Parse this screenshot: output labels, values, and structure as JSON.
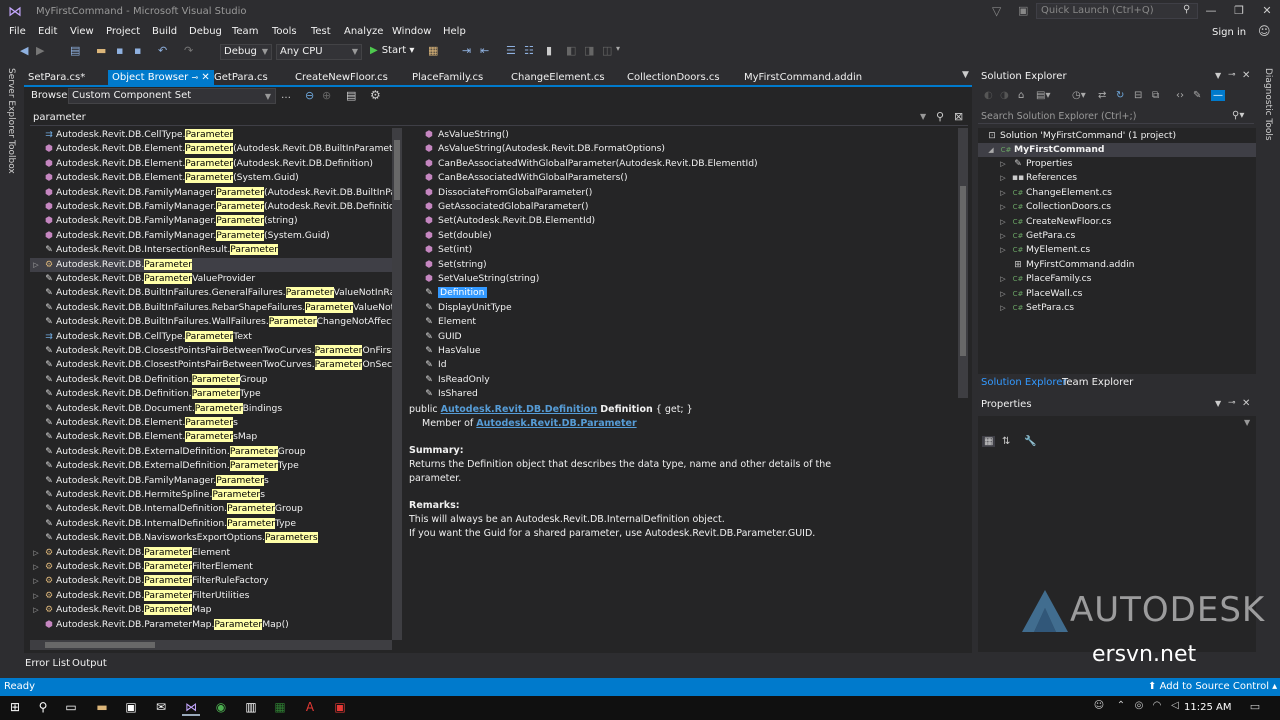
{
  "window": {
    "title": "MyFirstCommand - Microsoft Visual Studio",
    "quick_launch_placeholder": "Quick Launch (Ctrl+Q)",
    "sign_in": "Sign in"
  },
  "menu": [
    "File",
    "Edit",
    "View",
    "Project",
    "Build",
    "Debug",
    "Team",
    "Tools",
    "Test",
    "Analyze",
    "Window",
    "Help"
  ],
  "toolbar": {
    "config": "Debug",
    "platform": "Any CPU",
    "start": "Start"
  },
  "side_tabs": {
    "left": [
      "Server Explorer",
      "Toolbox"
    ],
    "right": [
      "Diagnostic Tools"
    ]
  },
  "doc_tabs": [
    "SetPara.cs*",
    "Object Browser",
    "GetPara.cs",
    "CreateNewFloor.cs",
    "PlaceFamily.cs",
    "ChangeElement.cs",
    "CollectionDoors.cs",
    "MyFirstCommand.addin"
  ],
  "object_browser": {
    "browse_label": "Browse:",
    "browse_value": "Custom Component Set",
    "search_value": "parameter",
    "tree": [
      {
        "pre": "Autodesk.Revit.DB.CellType.",
        "hl": "Parameter",
        "post": "",
        "icon": "enum",
        "exp": ""
      },
      {
        "pre": "Autodesk.Revit.DB.Element.",
        "hl": "Parameter",
        "post": "(Autodesk.Revit.DB.BuiltInParameter)",
        "icon": "method",
        "exp": ""
      },
      {
        "pre": "Autodesk.Revit.DB.Element.",
        "hl": "Parameter",
        "post": "(Autodesk.Revit.DB.Definition)",
        "icon": "method",
        "exp": ""
      },
      {
        "pre": "Autodesk.Revit.DB.Element.",
        "hl": "Parameter",
        "post": "(System.Guid)",
        "icon": "method",
        "exp": ""
      },
      {
        "pre": "Autodesk.Revit.DB.FamilyManager.",
        "hl": "Parameter",
        "post": "(Autodesk.Revit.DB.BuiltInParame",
        "icon": "method",
        "exp": ""
      },
      {
        "pre": "Autodesk.Revit.DB.FamilyManager.",
        "hl": "Parameter",
        "post": "(Autodesk.Revit.DB.Definition)",
        "icon": "method",
        "exp": ""
      },
      {
        "pre": "Autodesk.Revit.DB.FamilyManager.",
        "hl": "Parameter",
        "post": "(string)",
        "icon": "method",
        "exp": ""
      },
      {
        "pre": "Autodesk.Revit.DB.FamilyManager.",
        "hl": "Parameter",
        "post": "(System.Guid)",
        "icon": "method",
        "exp": ""
      },
      {
        "pre": "Autodesk.Revit.DB.IntersectionResult.",
        "hl": "Parameter",
        "post": "",
        "icon": "prop",
        "exp": ""
      },
      {
        "pre": "Autodesk.Revit.DB.",
        "hl": "Parameter",
        "post": "",
        "icon": "class",
        "exp": "▷",
        "selected": true
      },
      {
        "pre": "Autodesk.Revit.DB.",
        "hl": "Parameter",
        "post": "ValueProvider",
        "icon": "prop",
        "pre2": "Autodesk.Revit.DB.ParameterValueProvider.",
        "custom": true
      },
      {
        "pre": "Autodesk.Revit.DB.BuiltInFailures.GeneralFailures.",
        "hl": "Parameter",
        "post": "ValueNotInRange",
        "icon": "prop",
        "exp": ""
      },
      {
        "pre": "Autodesk.Revit.DB.BuiltInFailures.RebarShapeFailures.",
        "hl": "Parameter",
        "post": "ValueNotDefine",
        "icon": "prop",
        "exp": ""
      },
      {
        "pre": "Autodesk.Revit.DB.BuiltInFailures.WallFailures.",
        "hl": "Parameter",
        "post": "ChangeNotAffectingG",
        "icon": "prop",
        "exp": ""
      },
      {
        "pre": "Autodesk.Revit.DB.CellType.",
        "hl": "Parameter",
        "post": "Text",
        "icon": "enum",
        "exp": ""
      },
      {
        "pre": "Autodesk.Revit.DB.ClosestPointsPairBetweenTwoCurves.",
        "hl": "Parameter",
        "post": "OnFirstCurv",
        "icon": "prop",
        "exp": ""
      },
      {
        "pre": "Autodesk.Revit.DB.ClosestPointsPairBetweenTwoCurves.",
        "hl": "Parameter",
        "post": "OnSecondC",
        "icon": "prop",
        "exp": ""
      },
      {
        "pre": "Autodesk.Revit.DB.Definition.",
        "hl": "Parameter",
        "post": "Group",
        "icon": "prop",
        "exp": ""
      },
      {
        "pre": "Autodesk.Revit.DB.Definition.",
        "hl": "Parameter",
        "post": "Type",
        "icon": "prop",
        "exp": ""
      },
      {
        "pre": "Autodesk.Revit.DB.Document.",
        "hl": "Parameter",
        "post": "Bindings",
        "icon": "prop",
        "exp": ""
      },
      {
        "pre": "Autodesk.Revit.DB.Element.",
        "hl": "Parameter",
        "post": "s",
        "icon": "prop",
        "exp": ""
      },
      {
        "pre": "Autodesk.Revit.DB.Element.",
        "hl": "Parameter",
        "post": "sMap",
        "icon": "prop",
        "exp": ""
      },
      {
        "pre": "Autodesk.Revit.DB.ExternalDefinition.",
        "hl": "Parameter",
        "post": "Group",
        "icon": "prop",
        "exp": ""
      },
      {
        "pre": "Autodesk.Revit.DB.ExternalDefinition.",
        "hl": "Parameter",
        "post": "Type",
        "icon": "prop",
        "exp": ""
      },
      {
        "pre": "Autodesk.Revit.DB.FamilyManager.",
        "hl": "Parameter",
        "post": "s",
        "icon": "prop",
        "exp": ""
      },
      {
        "pre": "Autodesk.Revit.DB.HermiteSpline.",
        "hl": "Parameter",
        "post": "s",
        "icon": "prop",
        "exp": ""
      },
      {
        "pre": "Autodesk.Revit.DB.InternalDefinition.",
        "hl": "Parameter",
        "post": "Group",
        "icon": "prop",
        "exp": ""
      },
      {
        "pre": "Autodesk.Revit.DB.InternalDefinition.",
        "hl": "Parameter",
        "post": "Type",
        "icon": "prop",
        "exp": ""
      },
      {
        "pre": "Autodesk.Revit.DB.NavisworksExportOptions.",
        "hl": "Parameters",
        "post": "",
        "icon": "prop",
        "exp": ""
      },
      {
        "pre": "Autodesk.Revit.DB.",
        "hl": "Parameter",
        "post": "Element",
        "icon": "class",
        "exp": "▷"
      },
      {
        "pre": "Autodesk.Revit.DB.",
        "hl": "Parameter",
        "post": "FilterElement",
        "icon": "class",
        "exp": "▷"
      },
      {
        "pre": "Autodesk.Revit.DB.",
        "hl": "Parameter",
        "post": "FilterRuleFactory",
        "icon": "class",
        "exp": "▷"
      },
      {
        "pre": "Autodesk.Revit.DB.",
        "hl": "Parameter",
        "post": "FilterUtilities",
        "icon": "class",
        "exp": "▷"
      },
      {
        "pre": "Autodesk.Revit.DB.",
        "hl": "Parameter",
        "post": "Map",
        "icon": "class",
        "exp": "▷"
      },
      {
        "pre": "Autodesk.Revit.DB.ParameterMap.",
        "hl": "Parameter",
        "post": "Map()",
        "icon": "method",
        "exp": ""
      }
    ],
    "members": [
      {
        "name": "AsValueString()",
        "kind": "method"
      },
      {
        "name": "AsValueString(Autodesk.Revit.DB.FormatOptions)",
        "kind": "method"
      },
      {
        "name": "CanBeAssociatedWithGlobalParameter(Autodesk.Revit.DB.ElementId)",
        "kind": "method"
      },
      {
        "name": "CanBeAssociatedWithGlobalParameters()",
        "kind": "method"
      },
      {
        "name": "DissociateFromGlobalParameter()",
        "kind": "method"
      },
      {
        "name": "GetAssociatedGlobalParameter()",
        "kind": "method"
      },
      {
        "name": "Set(Autodesk.Revit.DB.ElementId)",
        "kind": "method"
      },
      {
        "name": "Set(double)",
        "kind": "method"
      },
      {
        "name": "Set(int)",
        "kind": "method"
      },
      {
        "name": "Set(string)",
        "kind": "method"
      },
      {
        "name": "SetValueString(string)",
        "kind": "method"
      },
      {
        "name": "Definition",
        "kind": "prop",
        "selected": true
      },
      {
        "name": "DisplayUnitType",
        "kind": "prop"
      },
      {
        "name": "Element",
        "kind": "prop"
      },
      {
        "name": "GUID",
        "kind": "prop"
      },
      {
        "name": "HasValue",
        "kind": "prop"
      },
      {
        "name": "Id",
        "kind": "prop"
      },
      {
        "name": "IsReadOnly",
        "kind": "prop"
      },
      {
        "name": "IsShared",
        "kind": "prop"
      }
    ],
    "description": {
      "decl_public": "public",
      "decl_type": "Autodesk.Revit.DB.Definition",
      "decl_name": "Definition",
      "decl_accessors": "{ get; }",
      "member_of_label": "Member of",
      "member_of_link": "Autodesk.Revit.DB.Parameter",
      "summary_label": "Summary:",
      "summary_line1": "Returns the Definition object that describes the data type, name and other details of the",
      "summary_line2": "parameter.",
      "remarks_label": "Remarks:",
      "remarks_line1": "This will always be an Autodesk.Revit.DB.InternalDefinition object.",
      "remarks_line2": "If you want the Guid for a shared parameter, use Autodesk.Revit.DB.Parameter.GUID."
    }
  },
  "bottom_tabs": [
    "Error List",
    "Output"
  ],
  "solution_explorer": {
    "title": "Solution Explorer",
    "search_placeholder": "Search Solution Explorer (Ctrl+;)",
    "solution": "Solution 'MyFirstCommand' (1 project)",
    "project": "MyFirstCommand",
    "items": [
      {
        "name": "Properties",
        "icon": "wrench",
        "exp": "▷"
      },
      {
        "name": "References",
        "icon": "ref",
        "exp": "▷"
      },
      {
        "name": "ChangeElement.cs",
        "icon": "cs",
        "exp": "▷"
      },
      {
        "name": "CollectionDoors.cs",
        "icon": "cs",
        "exp": "▷"
      },
      {
        "name": "CreateNewFloor.cs",
        "icon": "cs",
        "exp": "▷"
      },
      {
        "name": "GetPara.cs",
        "icon": "cs",
        "exp": "▷"
      },
      {
        "name": "MyElement.cs",
        "icon": "cs",
        "exp": "▷"
      },
      {
        "name": "MyFirstCommand.addin",
        "icon": "addin",
        "exp": ""
      },
      {
        "name": "PlaceFamily.cs",
        "icon": "cs",
        "exp": "▷"
      },
      {
        "name": "PlaceWall.cs",
        "icon": "cs",
        "exp": "▷"
      },
      {
        "name": "SetPara.cs",
        "icon": "cs",
        "exp": "▷"
      }
    ],
    "tab_solution": "Solution Explorer",
    "tab_team": "Team Explorer"
  },
  "properties": {
    "title": "Properties"
  },
  "watermarks": {
    "autodesk": "AUTODESK",
    "site": "ersvn.net"
  },
  "status": {
    "text": "Ready",
    "source_control": "Add to Source Control"
  },
  "taskbar": {
    "time": "11:25 AM"
  }
}
